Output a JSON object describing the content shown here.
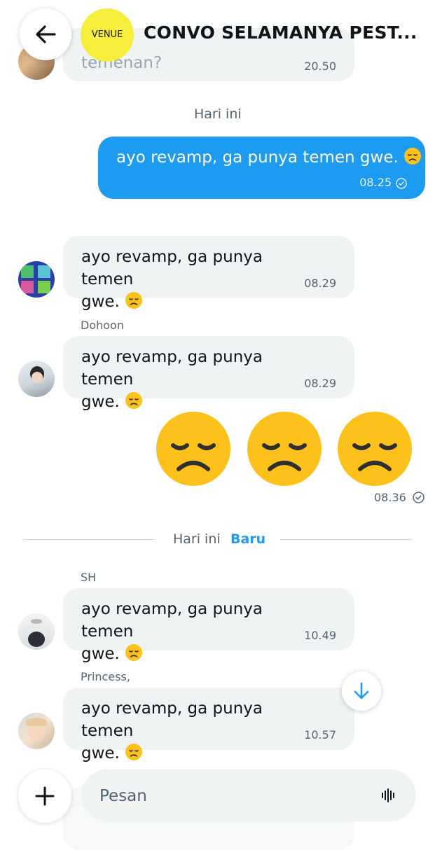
{
  "header": {
    "title": "CONVO SELAMANYA PEST...",
    "badge_label": "VENUE"
  },
  "messages_top": {
    "partial_text": "temenan?",
    "partial_time": "20.50"
  },
  "date_today": "Hari ini",
  "outgoing_1": {
    "text": "ayo revamp, ga punya temen gwe.",
    "time": "08.25"
  },
  "incoming": [
    {
      "sender": "",
      "line1": "ayo revamp, ga punya temen",
      "line2": "gwe.",
      "time": "08.29"
    },
    {
      "sender": "Dohoon",
      "line1": "ayo revamp, ga punya temen",
      "line2": "gwe.",
      "time": "08.29"
    },
    {
      "sender": "SH",
      "line1": "ayo revamp, ga punya temen",
      "line2": "gwe.",
      "time": "10.49"
    },
    {
      "sender": "Princess,",
      "line1": "ayo revamp, ga punya temen",
      "line2": "gwe.",
      "time": "10.57"
    }
  ],
  "outgoing_emoji": {
    "time": "08.36"
  },
  "divider": {
    "label": "Hari ini",
    "new_label": "Baru"
  },
  "composer": {
    "placeholder": "Pesan"
  },
  "colors": {
    "accent": "#1d9bf0",
    "bubble_in": "#eff3f4",
    "secondary_text": "#536471",
    "badge": "#f6ee3a"
  }
}
